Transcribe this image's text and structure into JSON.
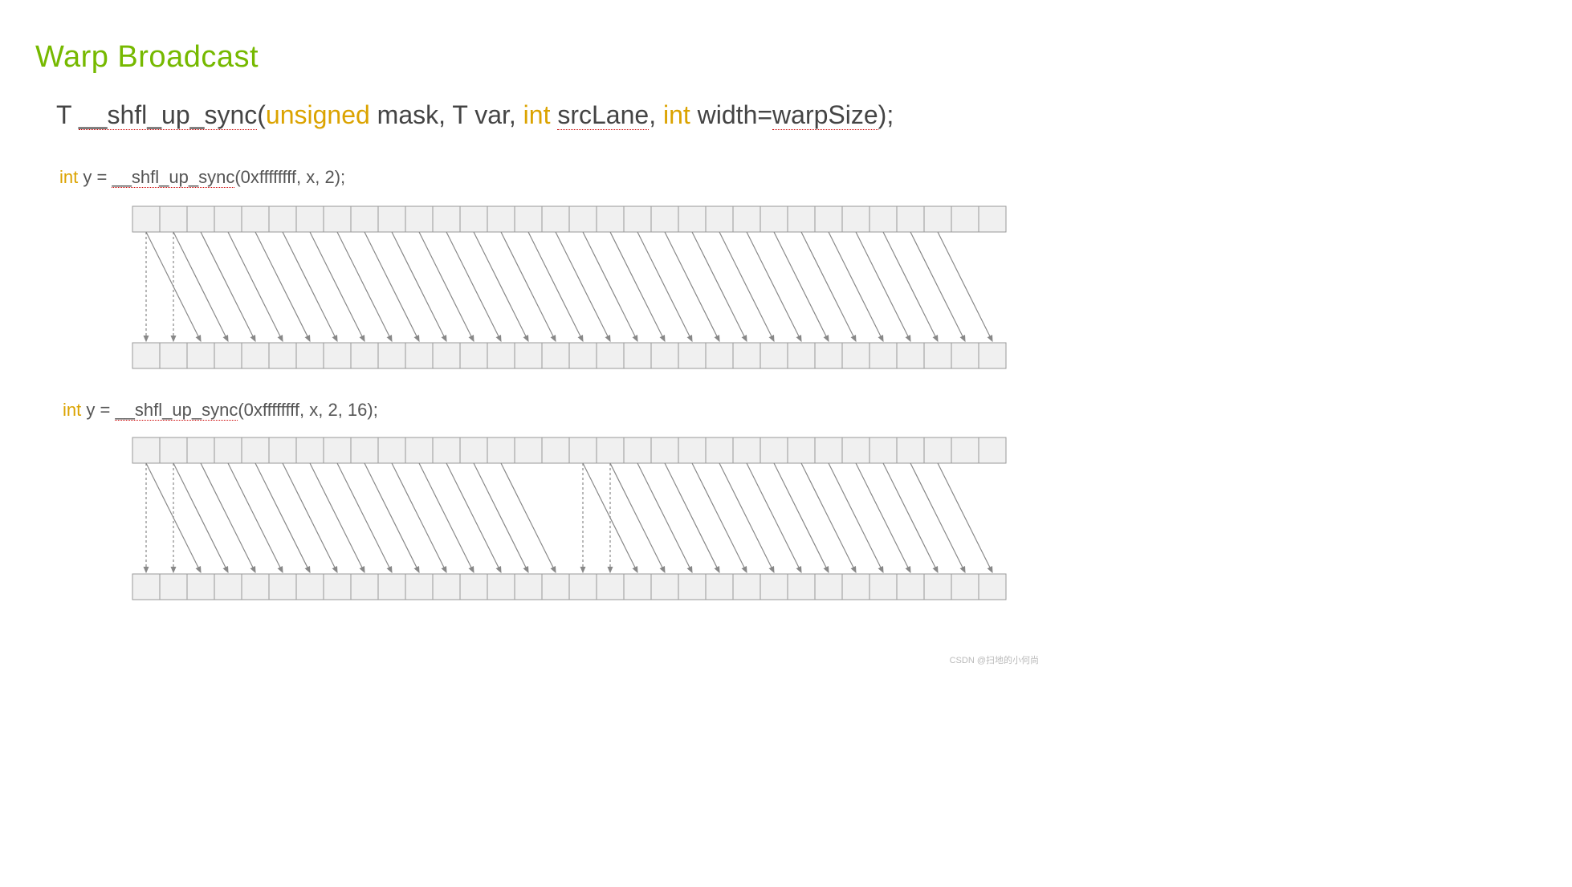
{
  "title": "Warp Broadcast",
  "signature": {
    "t1": "T ",
    "fn": "__shfl_up_sync",
    "p_open": "(",
    "kw_unsigned": "unsigned",
    "p_mask": " mask, T var, ",
    "kw_int1": "int",
    "p_src_sp": " ",
    "p_src": "srcLane",
    "p_comma": ", ",
    "kw_int2": "int",
    "p_width": " width=",
    "p_ws": "warpSize",
    "p_close": ");"
  },
  "example1": {
    "kw": "int",
    "rest_a": " y = ",
    "fn": "__shfl_up_sync",
    "args": "(0xffffffff, x, 2);"
  },
  "example2": {
    "kw": "int",
    "rest_a": " y = ",
    "fn": "__shfl_up_sync",
    "args": "(0xffffffff, x, 2, 16);"
  },
  "watermark": "CSDN @扫地的小何尚",
  "chart_data": [
    {
      "type": "diagram",
      "title": "__shfl_up_sync delta=2 width=32",
      "lanes": 32,
      "delta": 2,
      "width": 32,
      "arrows": [
        {
          "from": 0,
          "to": 0,
          "dotted": true
        },
        {
          "from": 1,
          "to": 1,
          "dotted": true
        },
        {
          "from": 0,
          "to": 2,
          "dotted": false
        },
        {
          "from": 1,
          "to": 3,
          "dotted": false
        },
        {
          "from": 2,
          "to": 4,
          "dotted": false
        },
        {
          "from": 3,
          "to": 5,
          "dotted": false
        },
        {
          "from": 4,
          "to": 6,
          "dotted": false
        },
        {
          "from": 5,
          "to": 7,
          "dotted": false
        },
        {
          "from": 6,
          "to": 8,
          "dotted": false
        },
        {
          "from": 7,
          "to": 9,
          "dotted": false
        },
        {
          "from": 8,
          "to": 10,
          "dotted": false
        },
        {
          "from": 9,
          "to": 11,
          "dotted": false
        },
        {
          "from": 10,
          "to": 12,
          "dotted": false
        },
        {
          "from": 11,
          "to": 13,
          "dotted": false
        },
        {
          "from": 12,
          "to": 14,
          "dotted": false
        },
        {
          "from": 13,
          "to": 15,
          "dotted": false
        },
        {
          "from": 14,
          "to": 16,
          "dotted": false
        },
        {
          "from": 15,
          "to": 17,
          "dotted": false
        },
        {
          "from": 16,
          "to": 18,
          "dotted": false
        },
        {
          "from": 17,
          "to": 19,
          "dotted": false
        },
        {
          "from": 18,
          "to": 20,
          "dotted": false
        },
        {
          "from": 19,
          "to": 21,
          "dotted": false
        },
        {
          "from": 20,
          "to": 22,
          "dotted": false
        },
        {
          "from": 21,
          "to": 23,
          "dotted": false
        },
        {
          "from": 22,
          "to": 24,
          "dotted": false
        },
        {
          "from": 23,
          "to": 25,
          "dotted": false
        },
        {
          "from": 24,
          "to": 26,
          "dotted": false
        },
        {
          "from": 25,
          "to": 27,
          "dotted": false
        },
        {
          "from": 26,
          "to": 28,
          "dotted": false
        },
        {
          "from": 27,
          "to": 29,
          "dotted": false
        },
        {
          "from": 28,
          "to": 30,
          "dotted": false
        },
        {
          "from": 29,
          "to": 31,
          "dotted": false
        }
      ]
    },
    {
      "type": "diagram",
      "title": "__shfl_up_sync delta=2 width=16",
      "lanes": 32,
      "delta": 2,
      "width": 16,
      "arrows": [
        {
          "from": 0,
          "to": 0,
          "dotted": true
        },
        {
          "from": 1,
          "to": 1,
          "dotted": true
        },
        {
          "from": 0,
          "to": 2,
          "dotted": false
        },
        {
          "from": 1,
          "to": 3,
          "dotted": false
        },
        {
          "from": 2,
          "to": 4,
          "dotted": false
        },
        {
          "from": 3,
          "to": 5,
          "dotted": false
        },
        {
          "from": 4,
          "to": 6,
          "dotted": false
        },
        {
          "from": 5,
          "to": 7,
          "dotted": false
        },
        {
          "from": 6,
          "to": 8,
          "dotted": false
        },
        {
          "from": 7,
          "to": 9,
          "dotted": false
        },
        {
          "from": 8,
          "to": 10,
          "dotted": false
        },
        {
          "from": 9,
          "to": 11,
          "dotted": false
        },
        {
          "from": 10,
          "to": 12,
          "dotted": false
        },
        {
          "from": 11,
          "to": 13,
          "dotted": false
        },
        {
          "from": 12,
          "to": 14,
          "dotted": false
        },
        {
          "from": 13,
          "to": 15,
          "dotted": false
        },
        {
          "from": 16,
          "to": 16,
          "dotted": true
        },
        {
          "from": 17,
          "to": 17,
          "dotted": true
        },
        {
          "from": 16,
          "to": 18,
          "dotted": false
        },
        {
          "from": 17,
          "to": 19,
          "dotted": false
        },
        {
          "from": 18,
          "to": 20,
          "dotted": false
        },
        {
          "from": 19,
          "to": 21,
          "dotted": false
        },
        {
          "from": 20,
          "to": 22,
          "dotted": false
        },
        {
          "from": 21,
          "to": 23,
          "dotted": false
        },
        {
          "from": 22,
          "to": 24,
          "dotted": false
        },
        {
          "from": 23,
          "to": 25,
          "dotted": false
        },
        {
          "from": 24,
          "to": 26,
          "dotted": false
        },
        {
          "from": 25,
          "to": 27,
          "dotted": false
        },
        {
          "from": 26,
          "to": 28,
          "dotted": false
        },
        {
          "from": 27,
          "to": 29,
          "dotted": false
        },
        {
          "from": 28,
          "to": 30,
          "dotted": false
        },
        {
          "from": 29,
          "to": 31,
          "dotted": false
        }
      ]
    }
  ]
}
